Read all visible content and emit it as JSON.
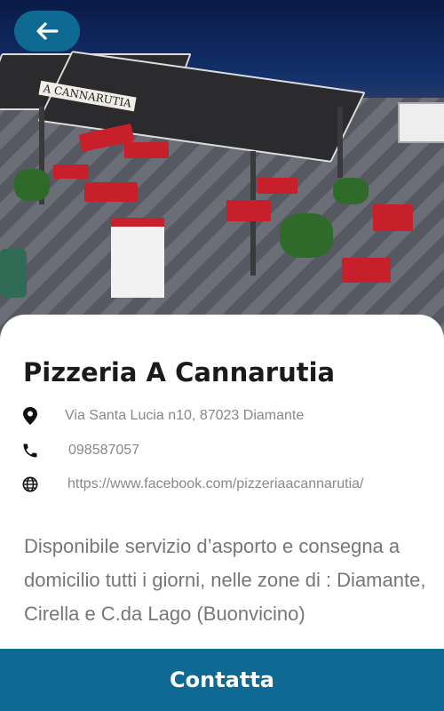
{
  "header": {
    "back_icon": "arrow-left-icon"
  },
  "hero": {
    "image_alt": "Outdoor terrace of the pizzeria at night",
    "sign_text": "A CANNARUTIA"
  },
  "place": {
    "name": "Pizzeria A Cannarutia",
    "address": "Via Santa Lucia n10, 87023 Diamante",
    "phone": "098587057",
    "website": "https://www.facebook.com/pizzeriaacannarutia/",
    "description": "Disponibile servizio d’asporto e consegna a domicilio tutti i giorni, nelle zone di : Diamante, Cirella e C.da Lago (Buonvicino)"
  },
  "icons": {
    "address": "map-pin-icon",
    "phone": "phone-icon",
    "website": "globe-icon"
  },
  "cta": {
    "label": "Contatta"
  },
  "colors": {
    "accent": "#0f6a93",
    "title": "#1a1a1a",
    "muted": "#888888"
  }
}
